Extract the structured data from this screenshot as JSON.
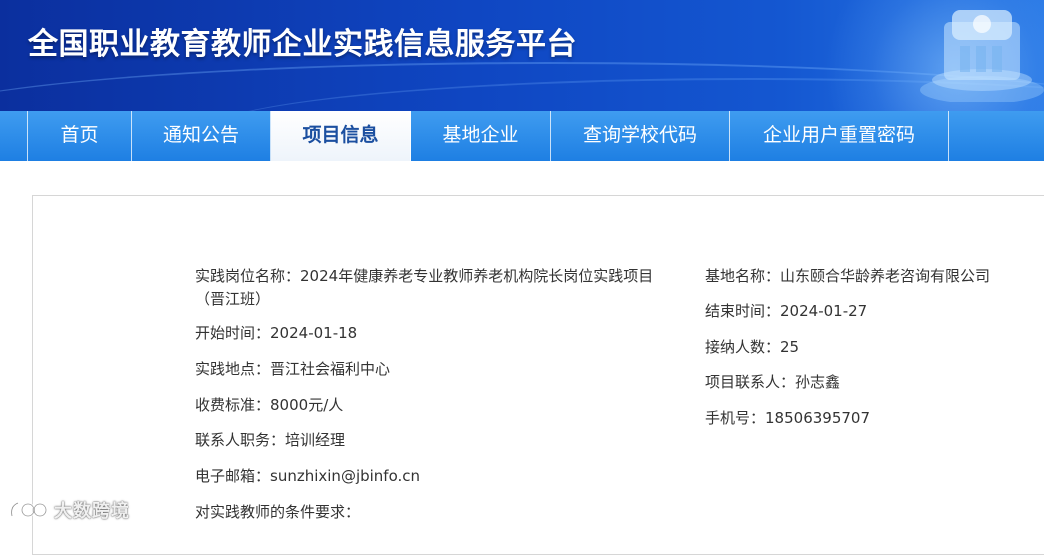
{
  "header": {
    "title": "全国职业教育教师企业实践信息服务平台"
  },
  "nav": {
    "items": [
      {
        "label": "首页"
      },
      {
        "label": "通知公告"
      },
      {
        "label": "项目信息"
      },
      {
        "label": "基地企业"
      },
      {
        "label": "查询学校代码"
      },
      {
        "label": "企业用户重置密码"
      }
    ],
    "active": "项目信息"
  },
  "project": {
    "position_label": "实践岗位名称：",
    "position_value": "2024年健康养老专业教师养老机构院长岗位实践项目（晋江班）",
    "start_label": "开始时间：",
    "start_value": "2024-01-18",
    "location_label": "实践地点：",
    "location_value": "晋江社会福利中心",
    "fee_label": "收费标准：",
    "fee_value": "8000元/人",
    "contact_role_label": "联系人职务：",
    "contact_role_value": "培训经理",
    "email_label": "电子邮箱：",
    "email_value": "sunzhixin@jbinfo.cn",
    "requirements_label": "对实践教师的条件要求：",
    "base_label": "基地名称：",
    "base_value": "山东颐合华龄养老咨询有限公司",
    "end_label": "结束时间：",
    "end_value": "2024-01-27",
    "capacity_label": "接纳人数：",
    "capacity_value": "25",
    "contact_label": "项目联系人：",
    "contact_value": "孙志鑫",
    "phone_label": "手机号：",
    "phone_value": "18506395707"
  },
  "watermark": {
    "text": "大数跨境"
  },
  "colors": {
    "banner": "#0f46c2",
    "nav": "#2b8be8",
    "active_tab_text": "#1b4fa0",
    "body_text": "#333333"
  }
}
